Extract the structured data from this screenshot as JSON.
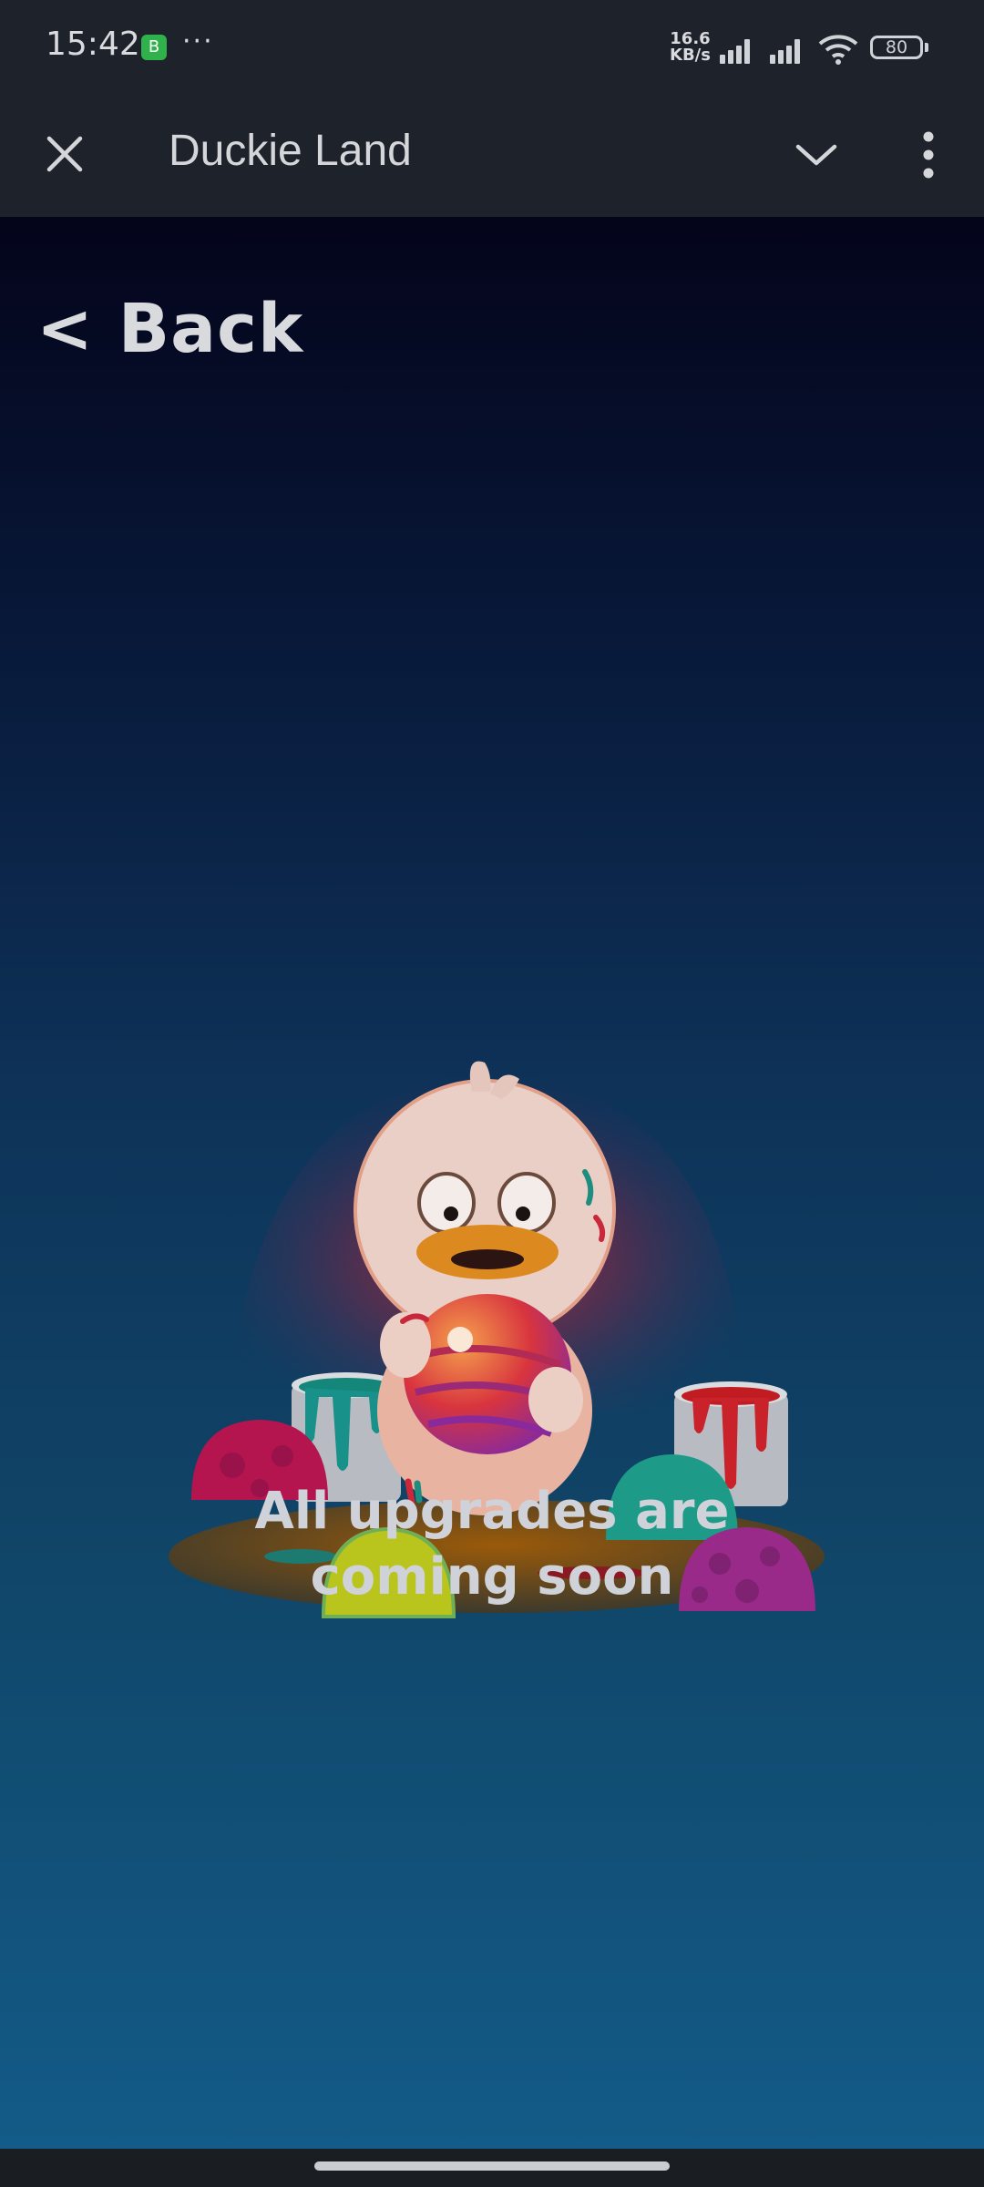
{
  "status_bar": {
    "time": "15:42",
    "app_badge": "B",
    "more": "···",
    "net_speed_value": "16.6",
    "net_speed_unit": "KB/s",
    "battery": "80"
  },
  "app_bar": {
    "title": "Duckie Land",
    "close_icon": "close-icon",
    "collapse_icon": "chevron-down-icon",
    "menu_icon": "more-vert-icon"
  },
  "game": {
    "back_label": "< Back",
    "message_line1": "All upgrades are",
    "message_line2": "coming soon"
  },
  "colors": {
    "bar_bg": "#1e222a",
    "gradient_top": "#04041a",
    "gradient_bottom": "#135b88",
    "text_light": "#d9dade"
  }
}
